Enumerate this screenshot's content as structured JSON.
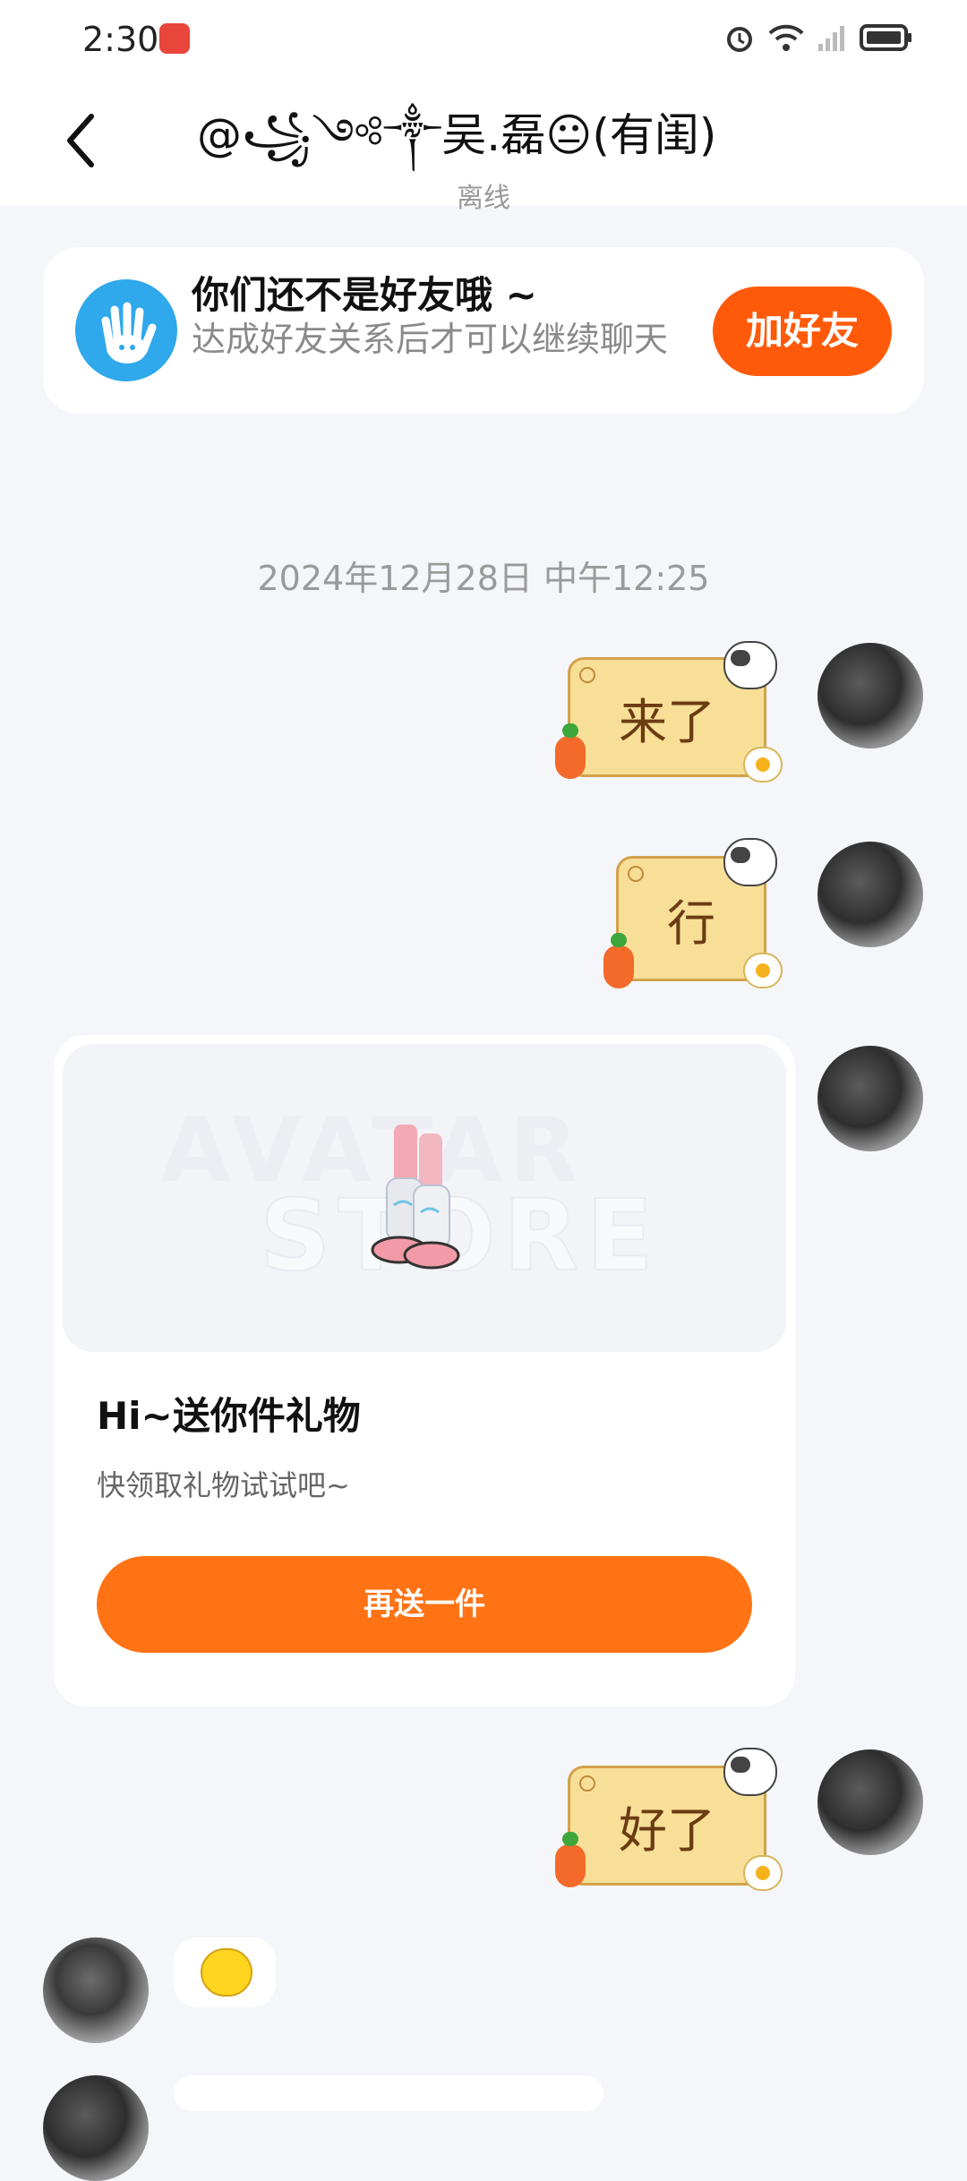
{
  "status_bar": {
    "time": "2:30",
    "app_icon": "huawei-appgallery-icon",
    "icons": [
      "alarm-icon",
      "wifi-icon",
      "signal-icon",
      "battery-icon"
    ]
  },
  "header": {
    "back_icon": "chevron-left-icon",
    "title": "@꧁༺༒吴.磊😐(有闺)",
    "status": "离线"
  },
  "friend_banner": {
    "icon": "hand-icon",
    "title": "你们还不是好友哦 ~",
    "description": "达成好友关系后才可以继续聊天",
    "button": "加好友"
  },
  "timestamp": "2024年12月28日 中午12:25",
  "messages": [
    {
      "sender": "self",
      "type": "sticker",
      "text": "来了"
    },
    {
      "sender": "self",
      "type": "sticker",
      "text": "行"
    },
    {
      "sender": "self",
      "type": "gift_card",
      "watermark_line1": "AVATAR",
      "watermark_line2": "STORE",
      "title": "Hi~送你件礼物",
      "subtitle": "快领取礼物试试吧~",
      "button": "再送一件"
    },
    {
      "sender": "self",
      "type": "sticker",
      "text": "好了"
    },
    {
      "sender": "other",
      "type": "emoji",
      "emoji": "yellow-bird-emoji"
    }
  ],
  "colors": {
    "accent": "#ff5a0a",
    "gift_button": "#ff7314",
    "sticker_bg": "#f7df98",
    "background": "#f4f6f9"
  }
}
